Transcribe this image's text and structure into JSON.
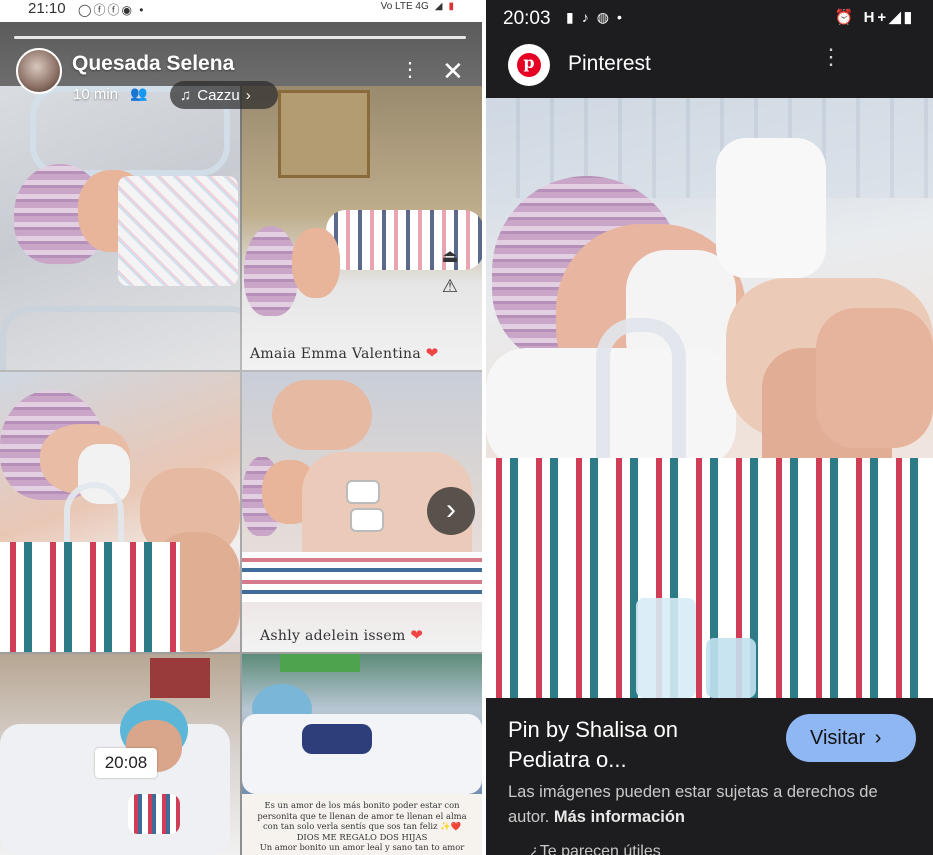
{
  "left_panel": {
    "status_bar": {
      "time": "21:10",
      "right_text": "Vo LTE  4G"
    },
    "story": {
      "username": "Quesada Selena",
      "elapsed": "10 min",
      "music_chip": "Cazzu",
      "captions": {
        "tile2": "Amaia Emma Valentina",
        "tile4": "Ashly adelein  issem"
      },
      "time_badge": "20:08",
      "quote_lines": [
        "Es un amor de los más bonito poder estar con",
        "personita que te llenan de amor te llenan el alma",
        "con tan solo verla sentís que sos tan feliz",
        "DIOS ME REGALO DOS HIJAS",
        "Un amor bonito un amor leal y sano tan to amor"
      ]
    }
  },
  "right_panel": {
    "status_bar": {
      "time": "20:03",
      "right_text": "H+"
    },
    "header": {
      "app_name": "Pinterest"
    },
    "pin": {
      "title_line1": "Pin by Shalisa on",
      "title_line2": "Pediatra o...",
      "visit_label": "Visitar",
      "disclaimer": "Las imágenes pueden estar sujetas a derechos de autor.",
      "more_info": "Más información",
      "helpful_partial": "¿Te parecen útiles"
    }
  },
  "icons": {
    "left_status": [
      "whatsapp-icon",
      "facebook-icon",
      "facebook-icon",
      "messenger-icon"
    ],
    "right_status": [
      "battery-saver-icon",
      "tiktok-icon",
      "app-icon",
      "alarm-icon",
      "signal-icon",
      "battery-icon"
    ]
  }
}
